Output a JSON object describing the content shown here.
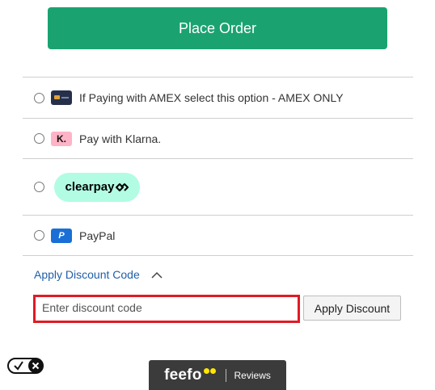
{
  "checkout": {
    "place_order_label": "Place Order"
  },
  "payment_methods": [
    {
      "label": "If Paying with AMEX select this option - AMEX ONLY",
      "icon": "amex-card-icon"
    },
    {
      "label": "Pay with Klarna.",
      "icon": "klarna-icon",
      "icon_text": "K."
    },
    {
      "label": "clearpay",
      "icon": "clearpay-logo"
    },
    {
      "label": "PayPal",
      "icon": "paypal-icon",
      "icon_text": "P"
    }
  ],
  "discount": {
    "toggle_label": "Apply Discount Code",
    "input_placeholder": "Enter discount code",
    "apply_label": "Apply Discount"
  },
  "feefo": {
    "logo_text": "feefo",
    "reviews_label": "Reviews"
  },
  "colors": {
    "primary_green": "#1aa371",
    "link_blue": "#1f5fa8",
    "highlight_red": "#e01b24",
    "clearpay_mint": "#b2fce4",
    "klarna_pink": "#ffb3c7",
    "paypal_blue": "#1a6fd6"
  }
}
